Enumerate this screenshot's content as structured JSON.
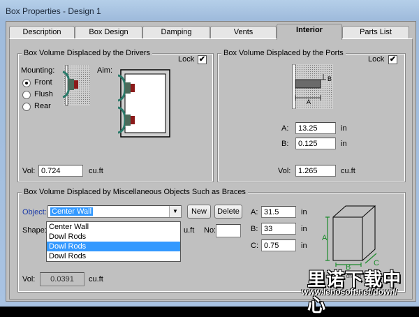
{
  "window": {
    "title": "Box Properties - Design 1"
  },
  "tabs": [
    {
      "label": "Description"
    },
    {
      "label": "Box Design"
    },
    {
      "label": "Damping"
    },
    {
      "label": "Vents"
    },
    {
      "label": "Interior"
    },
    {
      "label": "Parts List"
    }
  ],
  "drivers": {
    "group_title": "Box Volume Displaced by the Drivers",
    "lock_label": "Lock",
    "lock_checked": "✔",
    "mounting_label": "Mounting:",
    "mounting_options": [
      "Front",
      "Flush",
      "Rear"
    ],
    "aim_label": "Aim:",
    "vol_label": "Vol:",
    "vol_value": "0.724",
    "vol_unit": "cu.ft"
  },
  "ports": {
    "group_title": "Box Volume Displaced by the Ports",
    "lock_label": "Lock",
    "lock_checked": "✔",
    "diagram_a": "A",
    "diagram_b": "B",
    "a_label": "A:",
    "a_value": "13.25",
    "a_unit": "in",
    "b_label": "B:",
    "b_value": "0.125",
    "b_unit": "in",
    "vol_label": "Vol:",
    "vol_value": "1.265",
    "vol_unit": "cu.ft"
  },
  "misc": {
    "group_title": "Box Volume Displaced by Miscellaneous Objects Such as Braces",
    "object_label": "Object:",
    "object_value": "Center Wall",
    "new_label": "New",
    "delete_label": "Delete",
    "shape_label": "Shape:",
    "dropdown_items": [
      "Center Wall",
      "Dowl Rods",
      "Dowl Rods",
      "Dowl Rods"
    ],
    "cuft_label": "u.ft",
    "no_label": "No:",
    "no_value": "",
    "a_label": "A:",
    "a_value": "31.5",
    "a_unit": "in",
    "b_label": "B:",
    "b_value": "33",
    "b_unit": "in",
    "c_label": "C:",
    "c_value": "0.75",
    "c_unit": "in",
    "vol_label": "Vol:",
    "vol_value": "0.0391",
    "vol_unit": "cu.ft",
    "box_a": "A",
    "box_b": "B",
    "box_c": "C",
    "note": "--not drawn to scale--"
  },
  "watermark": {
    "line1": "里诺下载中心",
    "line2": "www.lenosoft.net/down/"
  }
}
